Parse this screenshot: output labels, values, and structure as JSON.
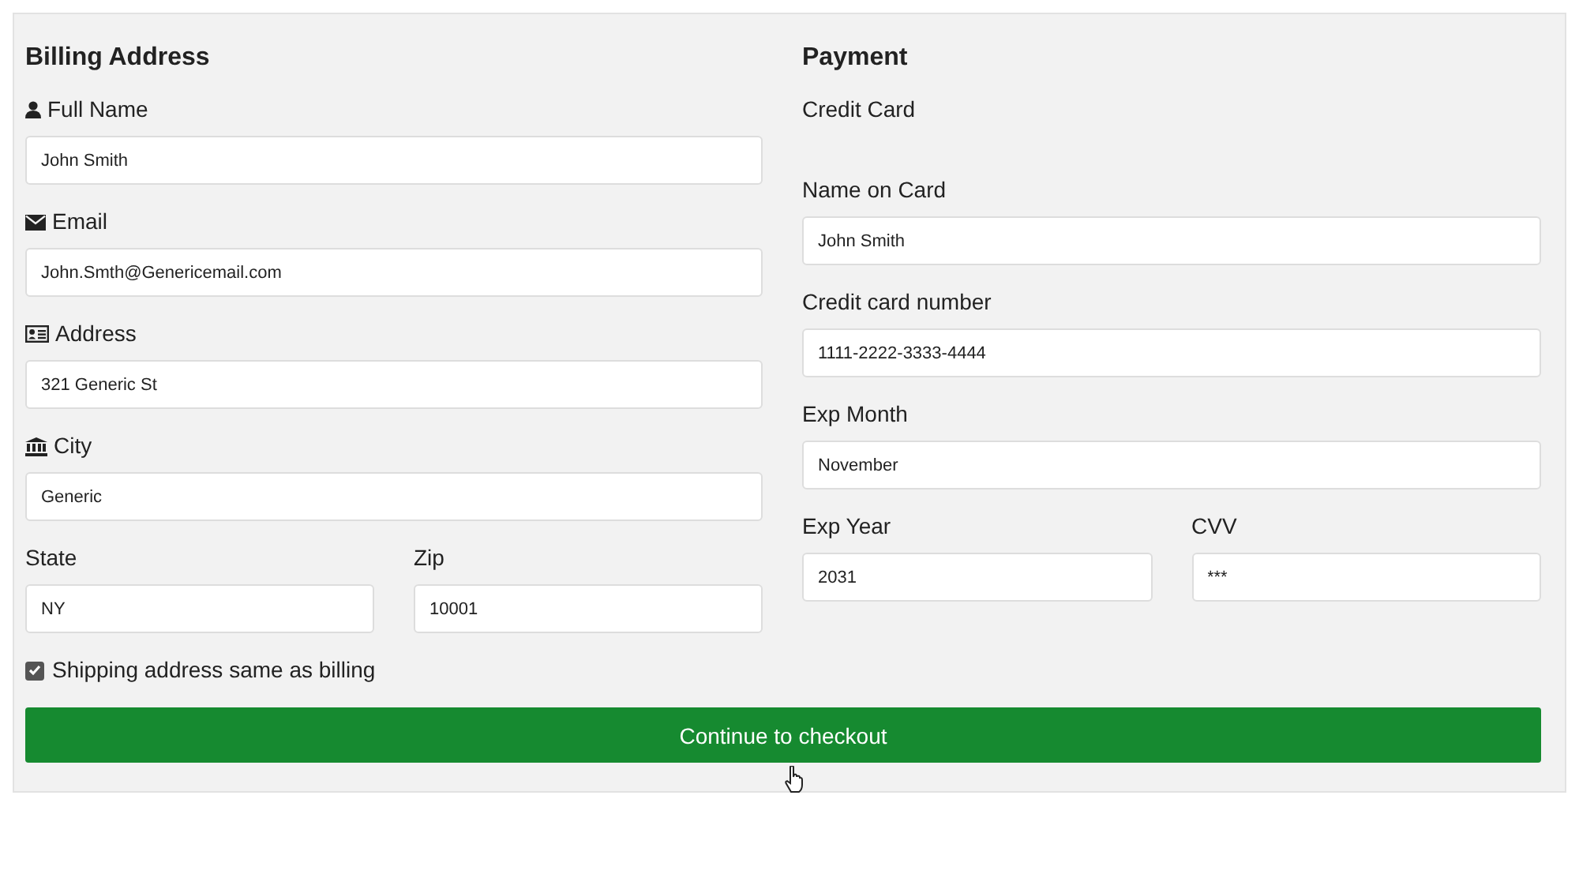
{
  "billing": {
    "title": "Billing Address",
    "fields": [
      {
        "label": "Full Name",
        "value": "John Smith"
      },
      {
        "label": "Email",
        "value": "John.Smth@Genericemail.com"
      },
      {
        "label": "Address",
        "value": "321 Generic St"
      },
      {
        "label": "City",
        "value": "Generic"
      }
    ],
    "pair": [
      {
        "label": "State",
        "value": "NY"
      },
      {
        "label": "Zip",
        "value": "10001"
      }
    ],
    "same_as_billing": {
      "label": "Shipping address same as billing",
      "checked": true
    }
  },
  "payment": {
    "title": "Payment",
    "subtitle": "Credit Card",
    "fields": [
      {
        "label": "Name on Card",
        "value": "John Smith"
      },
      {
        "label": "Credit card number",
        "value": "1111-2222-3333-4444"
      },
      {
        "label": "Exp Month",
        "value": "November"
      }
    ],
    "pair": [
      {
        "label": "Exp Year",
        "value": "2031"
      },
      {
        "label": "CVV",
        "value": "***"
      }
    ]
  },
  "submit": {
    "label": "Continue to checkout"
  }
}
